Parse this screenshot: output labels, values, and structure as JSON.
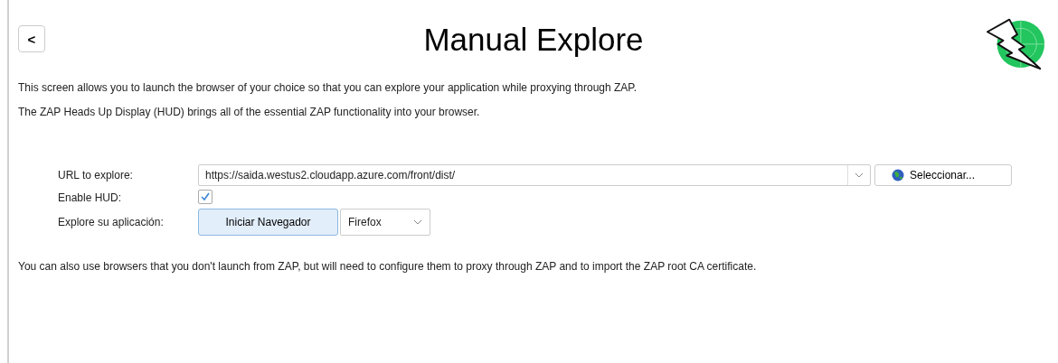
{
  "header": {
    "back": "<",
    "title": "Manual Explore"
  },
  "intro": [
    "This screen allows you to launch the browser of your choice so that you can explore your application while proxying through ZAP.",
    "The ZAP Heads Up Display (HUD) brings all of the essential ZAP functionality into your browser."
  ],
  "form": {
    "url_label": "URL to explore:",
    "url_value": "https://saida.westus2.cloudapp.azure.com/front/dist/",
    "select_button": "Seleccionar...",
    "hud_label": "Enable HUD:",
    "hud_checked": true,
    "explore_label": "Explore su aplicación:",
    "launch_button": "Iniciar Navegador",
    "browser": "Firefox"
  },
  "footer": "You can also use browsers that you don't launch from ZAP, but will need to configure them to proxy through ZAP and to import the ZAP root CA certificate."
}
